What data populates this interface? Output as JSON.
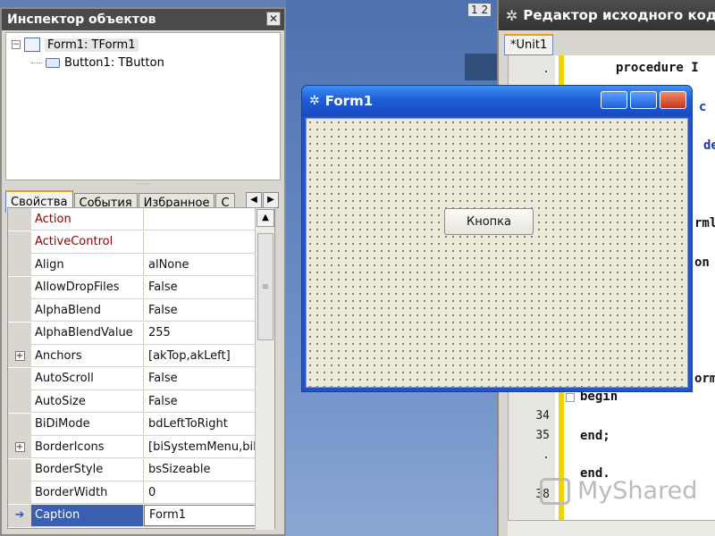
{
  "background": {
    "counter": "1 2"
  },
  "inspector": {
    "title": "Инспектор объектов",
    "close": "✕",
    "tree": [
      {
        "expander": "−",
        "label": "Form1: TForm1"
      },
      {
        "label": "Button1: TButton"
      }
    ],
    "dots": "······",
    "tabs": [
      "Свойства",
      "События",
      "Избранное",
      "С"
    ],
    "tab_arrows": [
      "◀",
      "▶"
    ],
    "scroll_up": "▲",
    "scroll_thumb": "≡",
    "properties": [
      {
        "name": "Action",
        "value": ""
      },
      {
        "name": "ActiveControl",
        "value": ""
      },
      {
        "name": "Align",
        "value": "alNone"
      },
      {
        "name": "AllowDropFiles",
        "value": "False"
      },
      {
        "name": "AlphaBlend",
        "value": "False"
      },
      {
        "name": "AlphaBlendValue",
        "value": "255"
      },
      {
        "name": "Anchors",
        "value": "[akTop,akLeft]",
        "expander": "+"
      },
      {
        "name": "AutoScroll",
        "value": "False"
      },
      {
        "name": "AutoSize",
        "value": "False"
      },
      {
        "name": "BiDiMode",
        "value": "bdLeftToRight"
      },
      {
        "name": "BorderIcons",
        "value": "[biSystemMenu,biM",
        "expander": "+"
      },
      {
        "name": "BorderStyle",
        "value": "bsSizeable"
      },
      {
        "name": "BorderWidth",
        "value": "0"
      },
      {
        "name": "Caption",
        "value": "Form1",
        "marker": "➔"
      }
    ]
  },
  "editor": {
    "title": "Редактор исходного кода",
    "tab": "*Unit1",
    "line_numbers": [
      ".",
      "34",
      "35",
      ".",
      "38"
    ],
    "code_lines": [
      "procedure I",
      "e c",
      "de",
      "rml",
      "on",
      "orm",
      "begin",
      "end;",
      "end."
    ]
  },
  "form": {
    "title": "Form1",
    "button_label": "Кнопка"
  },
  "watermark": "MyShared"
}
